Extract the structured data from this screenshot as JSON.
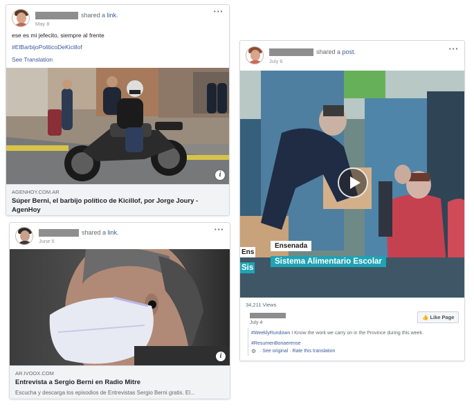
{
  "post1": {
    "action": "shared a",
    "action_link": "link.",
    "date": "May 8",
    "text": "ese es mi jefecito, siempre al frente",
    "hashtag": "#ElBarbijoPoliticoDeKicillof",
    "see_translation": "See Translation",
    "link": {
      "domain": "AGENHOY.COM.AR",
      "title_line1": "Súper Berni, el barbijo político de Kicillof, por Jorge Joury -",
      "title_line2": "AgenHoy"
    }
  },
  "post2": {
    "action": "shared a",
    "action_link": "link.",
    "date": "June 5",
    "link": {
      "domain": "AR.IVOOX.COM",
      "title": "Entrevista a Sergio Berni en Radio Mitre",
      "description": "Escucha y descarga los episodios de Entrevistas Sergio Berni gratis. El..."
    }
  },
  "post3": {
    "action": "shared a",
    "action_link": "post.",
    "date": "July 6",
    "video": {
      "caption_small": "Ensenada",
      "caption_main": "Sistema Alimentario Escolar",
      "left_small": "Ens",
      "left_main": "Sis"
    },
    "views": "34,211 Views",
    "inner_date": "July 4",
    "inner_hashtag": "#WeeklyRundown",
    "inner_text": " I Know the work we carry on in the Province during this week.",
    "inner_hashtag2": "#ResumenBonaerense",
    "see_original": "See original",
    "rate_translation": "Rate this translation",
    "like_page": "Like Page"
  },
  "icons": {
    "more": "more-options-icon",
    "info": "info-icon",
    "play": "play-icon",
    "like": "thumbs-up-icon",
    "gear": "gear-icon"
  },
  "colors": {
    "link_blue": "#385898",
    "caption_teal": "#1fa3b5",
    "redaction": "#8e8e8e"
  }
}
